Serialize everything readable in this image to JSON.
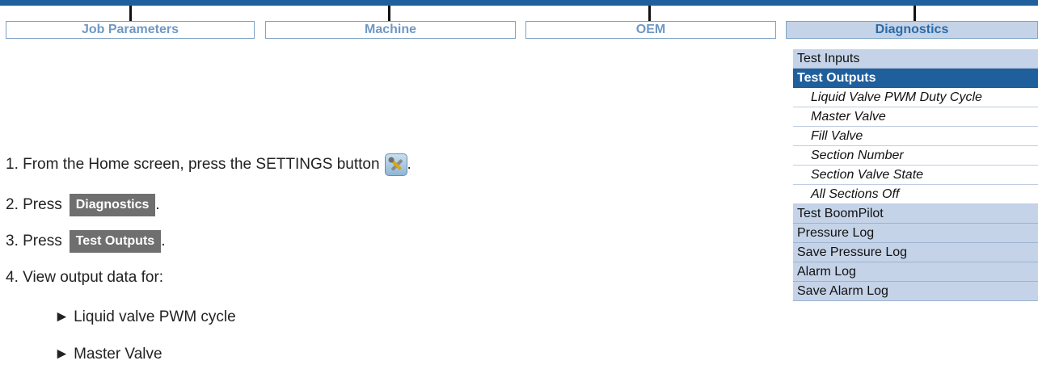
{
  "tabs": [
    {
      "label": "Job Parameters"
    },
    {
      "label": "Machine"
    },
    {
      "label": "OEM"
    },
    {
      "label": "Diagnostics"
    }
  ],
  "menu": {
    "test_inputs": "Test Inputs",
    "test_outputs": "Test Outputs",
    "sub_items": [
      "Liquid Valve PWM Duty Cycle",
      "Master Valve",
      "Fill Valve",
      "Section Number",
      "Section Valve State",
      "All Sections Off"
    ],
    "test_boompilot": "Test BoomPilot",
    "pressure_log": "Pressure Log",
    "save_pressure_log": "Save Pressure Log",
    "alarm_log": "Alarm Log",
    "save_alarm_log": "Save Alarm Log"
  },
  "instructions": {
    "step1": "1. From the Home screen, press the SETTINGS button",
    "step1_end": ".",
    "step2": "2. Press",
    "step2_button": "Diagnostics",
    "step2_end": ".",
    "step3": "3. Press",
    "step3_button": "Test Outputs",
    "step3_end": ".",
    "step4": "4. View output data for:",
    "bullets": [
      "► Liquid valve PWM cycle",
      "► Master Valve"
    ]
  },
  "icons": {
    "settings": "settings-tools-icon"
  },
  "colors": {
    "header_blue": "#1f5f9c",
    "menu_bg": "#c5d3e8",
    "button_gray": "#6f6f6f"
  }
}
